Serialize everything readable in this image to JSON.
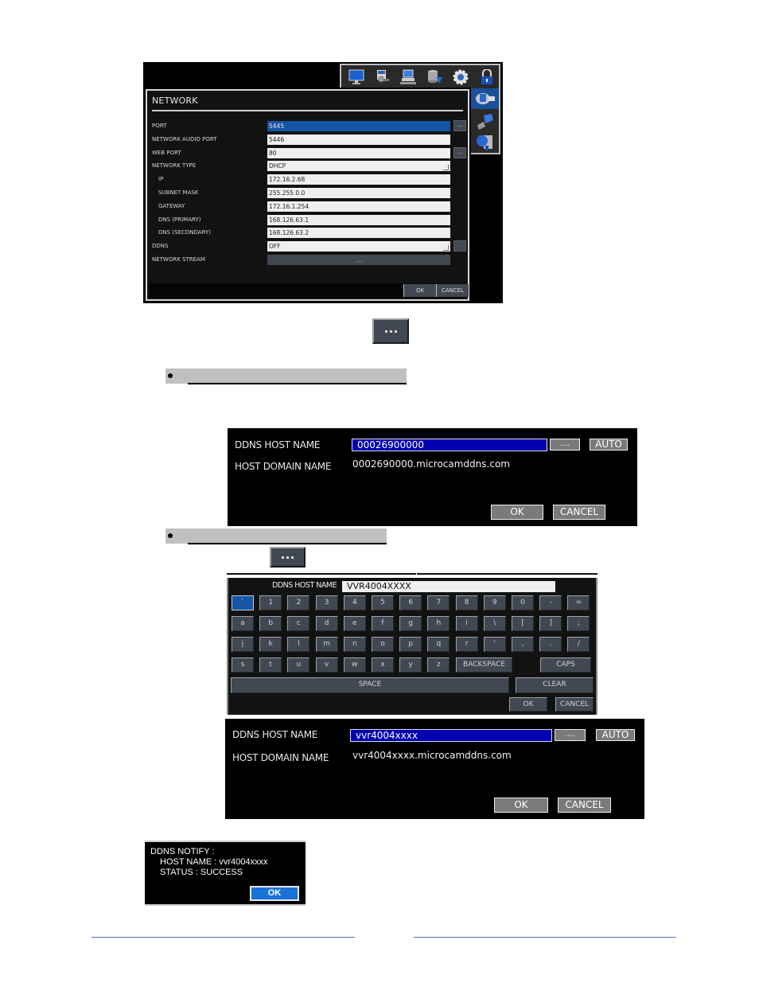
{
  "network_screen": {
    "title": "NETWORK",
    "top_icons": [
      "monitor-icon",
      "schedule-icon",
      "network-computer-icon",
      "storage-download-icon",
      "gear-icon",
      "lock-icon"
    ],
    "side_icons": [
      {
        "name": "network-settings-icon",
        "active": true
      },
      {
        "name": "usb-icon",
        "active": false
      },
      {
        "name": "database-search-icon",
        "active": false
      }
    ],
    "rows": [
      {
        "label": "PORT",
        "value": "5445",
        "selected": true,
        "indent": false,
        "more": true
      },
      {
        "label": "NETWORK AUDIO PORT",
        "value": "5446",
        "indent": false
      },
      {
        "label": "WEB PORT",
        "value": "80",
        "indent": false,
        "more": true
      },
      {
        "label": "NETWORK TYPE",
        "value": "DHCP",
        "indent": false,
        "dropdown": true
      },
      {
        "label": "IP",
        "value": "172.16.2.68",
        "indent": true
      },
      {
        "label": "SUBNET MASK",
        "value": "255.255.0.0",
        "indent": true
      },
      {
        "label": "GATEWAY",
        "value": "172.16.1.254",
        "indent": true
      },
      {
        "label": "DNS (PRIMARY)",
        "value": "168.126.63.1",
        "indent": true
      },
      {
        "label": "DNS (SECONDARY)",
        "value": "168.126.63.2",
        "indent": true
      },
      {
        "label": "DDNS",
        "value": "OFF",
        "indent": false,
        "dropdown": true,
        "more": true,
        "more_disabled": true
      },
      {
        "label": "NETWORK STREAM",
        "value": "...",
        "indent": false,
        "button": true
      }
    ],
    "more_label": "...",
    "ok_label": "OK",
    "cancel_label": "CANCEL"
  },
  "ddns_dialog_1": {
    "host_name_label": "DDNS HOST NAME",
    "host_name_value": "00026900000",
    "more_label": "....",
    "auto_label": "AUTO",
    "domain_label": "HOST DOMAIN NAME",
    "domain_value": "0002690000.microcamddns.com",
    "ok_label": "OK",
    "cancel_label": "CANCEL"
  },
  "keyboard": {
    "host_name_label": "DDNS HOST NAME",
    "input_value": "VVR4004XXXX",
    "rows": [
      [
        "`",
        "1",
        "2",
        "3",
        "4",
        "5",
        "6",
        "7",
        "8",
        "9",
        "0",
        "-",
        "="
      ],
      [
        "a",
        "b",
        "c",
        "d",
        "e",
        "f",
        "g",
        "h",
        "i",
        "\\",
        "[",
        "]",
        ";"
      ],
      [
        "j",
        "k",
        "l",
        "m",
        "n",
        "o",
        "p",
        "q",
        "r",
        "'",
        ",",
        ".",
        "/"
      ],
      [
        "s",
        "t",
        "u",
        "v",
        "w",
        "x",
        "y",
        "z"
      ]
    ],
    "active_key": "`",
    "backspace_label": "BACKSPACE",
    "caps_label": "CAPS",
    "space_label": "SPACE",
    "clear_label": "CLEAR",
    "ok_label": "OK",
    "cancel_label": "CANCEL"
  },
  "ddns_dialog_2": {
    "host_name_label": "DDNS HOST NAME",
    "host_name_value": "vvr4004xxxx",
    "more_label": "....",
    "auto_label": "AUTO",
    "domain_label": "HOST DOMAIN NAME",
    "domain_value": "vvr4004xxxx.microcamddns.com",
    "ok_label": "OK",
    "cancel_label": "CANCEL"
  },
  "notify": {
    "title": "DDNS NOTIFY :",
    "host_line": "HOST NAME : vvr4004xxxx",
    "status_line": "STATUS : SUCCESS",
    "ok_label": "OK"
  },
  "colors": {
    "selection_blue": "#1454a4",
    "ddns_field_blue": "#0000b0",
    "button_gray": "#7a7a7a",
    "key_gray": "#414851",
    "notify_ok_blue": "#1a73d9",
    "footer_line": "#4a7ac0"
  }
}
